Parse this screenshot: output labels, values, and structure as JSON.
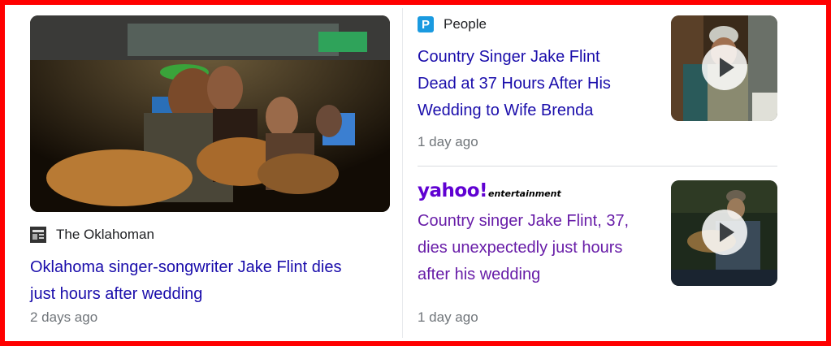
{
  "cards": [
    {
      "source": "The Oklahoman",
      "favicon": "newspaper-icon",
      "headline_lines": [
        "Oklahoma singer-songwriter Jake Flint dies",
        "just hours after wedding"
      ],
      "time": "2 days ago",
      "image": "band-performing-photo"
    },
    {
      "source": "People",
      "favicon": "people-p-icon",
      "favicon_color": "#1a9ae0",
      "favicon_letter": "P",
      "headline_lines": [
        "Country Singer Jake Flint",
        "Dead at 37 Hours After His",
        "Wedding to Wife Brenda"
      ],
      "time": "1 day ago",
      "thumbnail": "video-thumbnail",
      "play": "play-icon"
    },
    {
      "source_logo": "yahoo!",
      "source_logo_sub": "entertainment",
      "logo_color": "#6001d2",
      "headline_lines": [
        "Country singer Jake Flint, 37,",
        "dies unexpectedly just hours",
        "after his wedding"
      ],
      "time": "1 day ago",
      "thumbnail": "video-thumbnail",
      "play": "play-icon"
    }
  ],
  "colors": {
    "link": "#1a0dab",
    "visited": "#681da8",
    "meta": "#70757a",
    "frame": "#ff0000"
  }
}
